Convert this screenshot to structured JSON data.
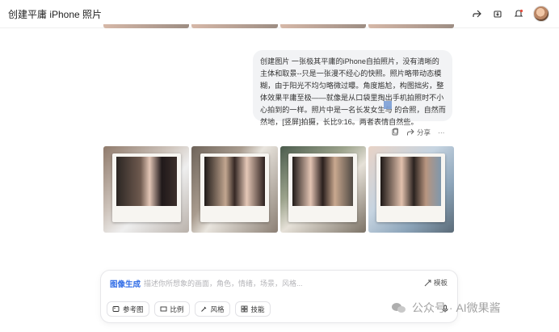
{
  "window": {
    "title": "创建平庸 iPhone 照片"
  },
  "topbar": {
    "icons": [
      "share-icon",
      "download-icon",
      "notification-icon",
      "avatar"
    ]
  },
  "message": {
    "text": "创建图片 一张极其平庸的iPhone自拍照片，没有清晰的主体和取景--只是一张漫不经心的快照。照片略带动态模糊，由于阳光不均匀略微过曝。角度尴尬，构图拙劣，整体效果平庸至极——就像是从口袋里掏出手机拍照时不小心拍到的一样。照片中是一名长发女生与 的合照，自然而然地，[竖屏]拍摄，长比9:16。两者表情自然些。",
    "actions": {
      "share_label": "分享",
      "more_label": "···"
    }
  },
  "gallery": {
    "items": [
      "photo-1",
      "photo-2",
      "photo-3",
      "photo-4"
    ]
  },
  "composer": {
    "mode_label": "图像生成",
    "placeholder": "描述你所想象的画面，角色，情绪，场景，风格...",
    "template_label": "模板",
    "tools": [
      {
        "icon": "image-icon",
        "label": "参考图"
      },
      {
        "icon": "ratio-icon",
        "label": "比例"
      },
      {
        "icon": "brush-icon",
        "label": "风格"
      },
      {
        "icon": "grid-icon",
        "label": "技能"
      }
    ]
  },
  "watermark": {
    "text": "公众号 · AI微果酱"
  },
  "colors": {
    "accent": "#2e6be6",
    "bubble": "#f2f3f5"
  }
}
